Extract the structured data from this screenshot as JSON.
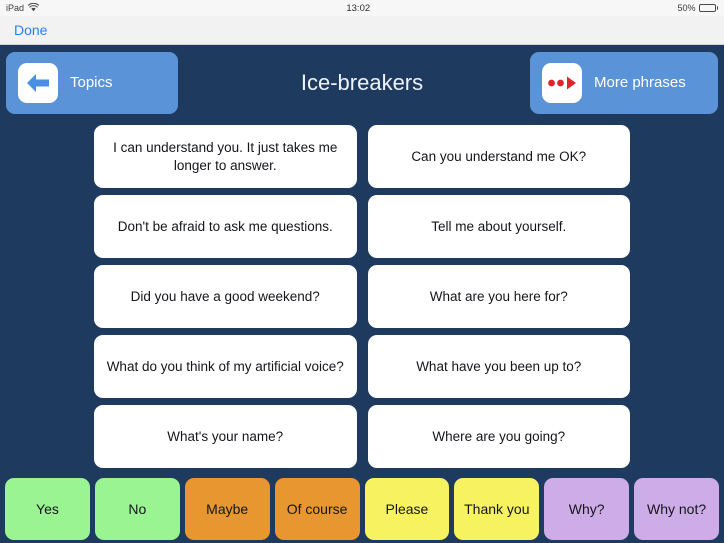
{
  "status_bar": {
    "carrier_label": "iPad",
    "wifi_icon": "wifi-icon",
    "time": "13:02",
    "battery_percent": "50%",
    "battery_level": 50
  },
  "toolbar": {
    "done_label": "Done"
  },
  "header": {
    "title": "Ice-breakers",
    "back_button": {
      "label": "Topics",
      "icon": "left-arrow-icon"
    },
    "more_button": {
      "label": "More phrases",
      "icon": "more-phrases-icon"
    }
  },
  "phrases": [
    {
      "text": "I can understand you. It just takes me longer to answer."
    },
    {
      "text": "Can you understand me OK?"
    },
    {
      "text": "Don't be afraid to ask me questions."
    },
    {
      "text": "Tell me about yourself."
    },
    {
      "text": "Did you have a good weekend?"
    },
    {
      "text": "What are you here for?"
    },
    {
      "text": "What do you think of my artificial voice?"
    },
    {
      "text": "What have you been up to?"
    },
    {
      "text": "What's your name?"
    },
    {
      "text": "Where are you going?"
    }
  ],
  "quick_replies": [
    {
      "label": "Yes",
      "color": "#9bf492"
    },
    {
      "label": "No",
      "color": "#9bf492"
    },
    {
      "label": "Maybe",
      "color": "#e8962f"
    },
    {
      "label": "Of course",
      "color": "#e8962f"
    },
    {
      "label": "Please",
      "color": "#f7f260"
    },
    {
      "label": "Thank you",
      "color": "#f7f260"
    },
    {
      "label": "Why?",
      "color": "#cdace8"
    },
    {
      "label": "Why not?",
      "color": "#cdace8"
    }
  ],
  "colors": {
    "background": "#1e3a5f",
    "nav_button": "#5b93d8",
    "card": "#ffffff",
    "done_blue": "#2a7ef0"
  }
}
